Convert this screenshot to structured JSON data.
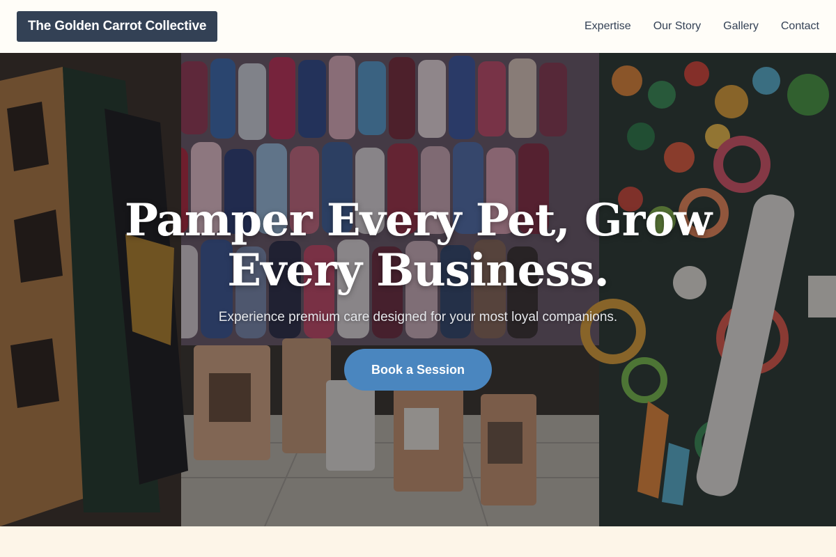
{
  "nav": {
    "brand": "The Golden Carrot Collective",
    "links": [
      "Expertise",
      "Our Story",
      "Gallery",
      "Contact"
    ]
  },
  "hero": {
    "title": "Pamper Every Pet, Grow Every Business.",
    "subtitle": "Experience premium care designed for your most loyal companions.",
    "cta_label": "Book a Session",
    "background_description_icon": "pet-shop-photo"
  },
  "colors": {
    "brand_bg": "#334155",
    "cta_bg": "#4a86bf",
    "page_bg": "#fdf5e8",
    "nav_bg": "#fffdf8"
  }
}
